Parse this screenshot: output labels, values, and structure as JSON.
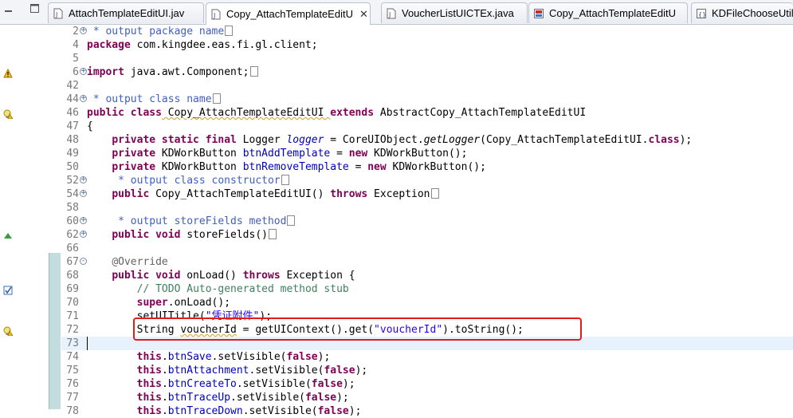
{
  "tabs": [
    {
      "label": "AttachTemplateEditUI.jav",
      "icon": "java-file-icon",
      "active": false
    },
    {
      "label": "Copy_AttachTemplateEditU",
      "icon": "java-file-icon",
      "active": true,
      "close": "✕"
    },
    {
      "label": "VoucherListUICTEx.java",
      "icon": "java-file-icon",
      "active": false
    },
    {
      "label": "Copy_AttachTemplateEditU",
      "icon": "class-file-icon",
      "active": false
    },
    {
      "label": "KDFileChooseUtils",
      "icon": "class-file-icon",
      "active": false
    }
  ],
  "window_controls": [
    "minimize-icon",
    "maximize-icon"
  ],
  "colors": {
    "keyword": "#7f0055",
    "javadoc": "#3f5fbf",
    "comment": "#3f7f5f",
    "field": "#0000c0",
    "string": "#2a00ff",
    "annotation": "#646464",
    "highlight": "#e41b1b"
  },
  "code_lines": [
    {
      "num": "2",
      "fold": "+",
      "parts": [
        {
          "t": " * output package name",
          "c": "cm"
        },
        {
          "box": true
        }
      ]
    },
    {
      "num": "4",
      "parts": [
        {
          "t": "package",
          "c": "kw"
        },
        {
          "t": " com.kingdee.eas.fi.gl.client;"
        }
      ]
    },
    {
      "num": "5",
      "parts": []
    },
    {
      "num": "6",
      "fold": "+",
      "marker": "warning",
      "parts": [
        {
          "t": "import",
          "c": "kw"
        },
        {
          "t": " java.awt.Component;"
        },
        {
          "box": true
        }
      ]
    },
    {
      "num": "42",
      "parts": []
    },
    {
      "num": "44",
      "fold": "+",
      "parts": [
        {
          "t": " * output class name",
          "c": "cm"
        },
        {
          "box": true
        }
      ]
    },
    {
      "num": "46",
      "marker": "warning-lightbulb",
      "parts": [
        {
          "t": "public class",
          "c": "kw"
        },
        {
          "t": " Copy_AttachTemplateEditUI ",
          "c": "squig"
        },
        {
          "t": "extends",
          "c": "kw"
        },
        {
          "t": " AbstractCopy_AttachTemplateEditUI"
        }
      ]
    },
    {
      "num": "47",
      "parts": [
        {
          "t": "{"
        }
      ]
    },
    {
      "num": "48",
      "parts": [
        {
          "t": "    "
        },
        {
          "t": "private static final",
          "c": "kw"
        },
        {
          "t": " Logger "
        },
        {
          "t": "logger",
          "c": "fd it"
        },
        {
          "t": " = CoreUIObject."
        },
        {
          "t": "getLogger",
          "c": "it"
        },
        {
          "t": "(Copy_AttachTemplateEditUI."
        },
        {
          "t": "class",
          "c": "kw"
        },
        {
          "t": ");"
        }
      ]
    },
    {
      "num": "49",
      "parts": [
        {
          "t": "    "
        },
        {
          "t": "private",
          "c": "kw"
        },
        {
          "t": " KDWorkButton "
        },
        {
          "t": "btnAddTemplate",
          "c": "fd"
        },
        {
          "t": " = "
        },
        {
          "t": "new",
          "c": "kw"
        },
        {
          "t": " KDWorkButton();"
        }
      ]
    },
    {
      "num": "50",
      "parts": [
        {
          "t": "    "
        },
        {
          "t": "private",
          "c": "kw"
        },
        {
          "t": " KDWorkButton "
        },
        {
          "t": "btnRemoveTemplate",
          "c": "fd"
        },
        {
          "t": " = "
        },
        {
          "t": "new",
          "c": "kw"
        },
        {
          "t": " KDWorkButton();"
        }
      ]
    },
    {
      "num": "52",
      "fold": "+",
      "parts": [
        {
          "t": "     * output class constructor",
          "c": "cm"
        },
        {
          "box": true
        }
      ]
    },
    {
      "num": "54",
      "fold": "+",
      "parts": [
        {
          "t": "    "
        },
        {
          "t": "public",
          "c": "kw"
        },
        {
          "t": " Copy_AttachTemplateEditUI() "
        },
        {
          "t": "throws",
          "c": "kw"
        },
        {
          "t": " Exception"
        },
        {
          "box": true
        }
      ]
    },
    {
      "num": "58",
      "parts": []
    },
    {
      "num": "60",
      "fold": "+",
      "parts": [
        {
          "t": "     * output storeFields method",
          "c": "cm"
        },
        {
          "box": true
        }
      ]
    },
    {
      "num": "62",
      "fold": "+",
      "marker": "override",
      "parts": [
        {
          "t": "    "
        },
        {
          "t": "public void",
          "c": "kw"
        },
        {
          "t": " storeFields()"
        },
        {
          "box": true
        }
      ]
    },
    {
      "num": "66",
      "parts": []
    },
    {
      "num": "67",
      "fold": "-",
      "change": true,
      "parts": [
        {
          "t": "    "
        },
        {
          "t": "@Override",
          "c": "an"
        }
      ]
    },
    {
      "num": "68",
      "change": true,
      "parts": [
        {
          "t": "    "
        },
        {
          "t": "public void",
          "c": "kw"
        },
        {
          "t": " onLoad() "
        },
        {
          "t": "throws",
          "c": "kw"
        },
        {
          "t": " Exception {"
        }
      ]
    },
    {
      "num": "69",
      "change": true,
      "marker": "task",
      "parts": [
        {
          "t": "        "
        },
        {
          "t": "// TODO Auto-generated method stub",
          "c": "lc"
        }
      ]
    },
    {
      "num": "70",
      "change": true,
      "parts": [
        {
          "t": "        "
        },
        {
          "t": "super",
          "c": "kw"
        },
        {
          "t": ".onLoad();"
        }
      ]
    },
    {
      "num": "71",
      "change": true,
      "parts": [
        {
          "t": "        setUITitle("
        },
        {
          "t": "\"凭证附件\"",
          "c": "str"
        },
        {
          "t": ");"
        }
      ]
    },
    {
      "num": "72",
      "change": true,
      "marker": "warning-lightbulb",
      "parts": [
        {
          "t": "        String "
        },
        {
          "t": "voucherId",
          "c": "squig"
        },
        {
          "t": " = getUIContext().get("
        },
        {
          "t": "\"voucherId\"",
          "c": "str"
        },
        {
          "t": ").toString();"
        }
      ]
    },
    {
      "num": "73",
      "change": true,
      "current": true,
      "parts": []
    },
    {
      "num": "74",
      "change": true,
      "parts": [
        {
          "t": "        "
        },
        {
          "t": "this",
          "c": "kw"
        },
        {
          "t": "."
        },
        {
          "t": "btnSave",
          "c": "fd"
        },
        {
          "t": ".setVisible("
        },
        {
          "t": "false",
          "c": "kw"
        },
        {
          "t": ");"
        }
      ]
    },
    {
      "num": "75",
      "change": true,
      "parts": [
        {
          "t": "        "
        },
        {
          "t": "this",
          "c": "kw"
        },
        {
          "t": "."
        },
        {
          "t": "btnAttachment",
          "c": "fd"
        },
        {
          "t": ".setVisible("
        },
        {
          "t": "false",
          "c": "kw"
        },
        {
          "t": ");"
        }
      ]
    },
    {
      "num": "76",
      "change": true,
      "parts": [
        {
          "t": "        "
        },
        {
          "t": "this",
          "c": "kw"
        },
        {
          "t": "."
        },
        {
          "t": "btnCreateTo",
          "c": "fd"
        },
        {
          "t": ".setVisible("
        },
        {
          "t": "false",
          "c": "kw"
        },
        {
          "t": ");"
        }
      ]
    },
    {
      "num": "77",
      "change": true,
      "parts": [
        {
          "t": "        "
        },
        {
          "t": "this",
          "c": "kw"
        },
        {
          "t": "."
        },
        {
          "t": "btnTraceUp",
          "c": "fd"
        },
        {
          "t": ".setVisible("
        },
        {
          "t": "false",
          "c": "kw"
        },
        {
          "t": ");"
        }
      ]
    },
    {
      "num": "78",
      "change": true,
      "parts": [
        {
          "t": "        "
        },
        {
          "t": "this",
          "c": "kw"
        },
        {
          "t": "."
        },
        {
          "t": "btnTraceDown",
          "c": "fd"
        },
        {
          "t": ".setVisible("
        },
        {
          "t": "false",
          "c": "kw"
        },
        {
          "t": ");"
        }
      ]
    }
  ]
}
